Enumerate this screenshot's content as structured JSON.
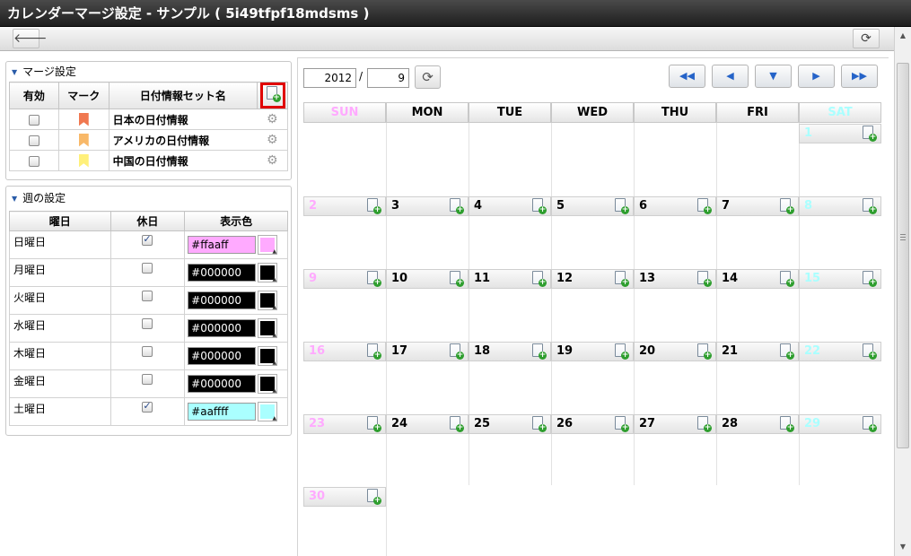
{
  "window": {
    "title": "カレンダーマージ設定 - サンプル ( 5i49tfpf18mdsms )"
  },
  "toolbar": {
    "back_icon": "arrow-left-icon",
    "refresh_icon": "refresh-icon"
  },
  "merge": {
    "title": "マージ設定",
    "headers": {
      "enabled": "有効",
      "mark": "マーク",
      "name": "日付情報セット名"
    },
    "rows": [
      {
        "name": "日本の日付情報",
        "mark_color": "#f07850"
      },
      {
        "name": "アメリカの日付情報",
        "mark_color": "#f8b868"
      },
      {
        "name": "中国の日付情報",
        "mark_color": "#fff07a"
      }
    ]
  },
  "week": {
    "title": "週の設定",
    "headers": {
      "day": "曜日",
      "holiday": "休日",
      "color": "表示色"
    },
    "rows": [
      {
        "day": "日曜日",
        "holiday": true,
        "color": "#ffaaff"
      },
      {
        "day": "月曜日",
        "holiday": false,
        "color": "#000000"
      },
      {
        "day": "火曜日",
        "holiday": false,
        "color": "#000000"
      },
      {
        "day": "水曜日",
        "holiday": false,
        "color": "#000000"
      },
      {
        "day": "木曜日",
        "holiday": false,
        "color": "#000000"
      },
      {
        "day": "金曜日",
        "holiday": false,
        "color": "#000000"
      },
      {
        "day": "土曜日",
        "holiday": true,
        "color": "#aaffff"
      }
    ]
  },
  "calendar": {
    "year": "2012",
    "separator": "/",
    "month": "9",
    "nav_icons": [
      "double-left-icon",
      "left-icon",
      "down-icon",
      "right-icon",
      "double-right-icon"
    ],
    "weekdays": [
      "SUN",
      "MON",
      "TUE",
      "WED",
      "THU",
      "FRI",
      "SAT"
    ],
    "sun_color": "#ffaaff",
    "sat_color": "#aaffff",
    "weeks": [
      [
        "",
        "",
        "",
        "",
        "",
        "",
        "1"
      ],
      [
        "2",
        "3",
        "4",
        "5",
        "6",
        "7",
        "8"
      ],
      [
        "9",
        "10",
        "11",
        "12",
        "13",
        "14",
        "15"
      ],
      [
        "16",
        "17",
        "18",
        "19",
        "20",
        "21",
        "22"
      ],
      [
        "23",
        "24",
        "25",
        "26",
        "27",
        "28",
        "29"
      ],
      [
        "30",
        "",
        "",
        "",
        "",
        "",
        ""
      ]
    ]
  }
}
